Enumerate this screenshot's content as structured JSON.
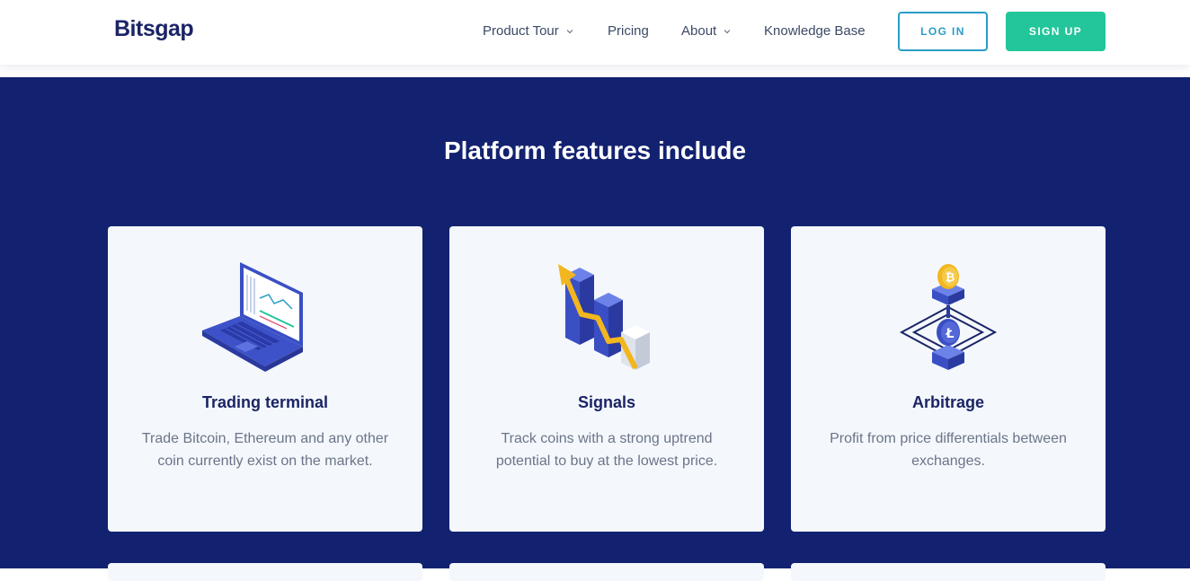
{
  "header": {
    "logo": "Bitsgap",
    "nav": [
      {
        "label": "Product Tour",
        "has_dropdown": true
      },
      {
        "label": "Pricing",
        "has_dropdown": false
      },
      {
        "label": "About",
        "has_dropdown": true
      },
      {
        "label": "Knowledge Base",
        "has_dropdown": false
      }
    ],
    "login_label": "LOG IN",
    "signup_label": "SIGN UP"
  },
  "features": {
    "title": "Platform features include",
    "cards": [
      {
        "icon": "laptop-icon",
        "title": "Trading terminal",
        "text": "Trade Bitcoin, Ethereum and any other coin currently exist on the market."
      },
      {
        "icon": "signals-chart-icon",
        "title": "Signals",
        "text": "Track coins with a strong uptrend potential to buy at the lowest price."
      },
      {
        "icon": "arbitrage-coins-icon",
        "title": "Arbitrage",
        "text": "Profit from price differentials between exchanges."
      }
    ]
  },
  "colors": {
    "brand_navy": "#132270",
    "accent_blue": "#2a9dc6",
    "accent_green": "#23c59a",
    "card_bg": "#f4f8fc"
  }
}
